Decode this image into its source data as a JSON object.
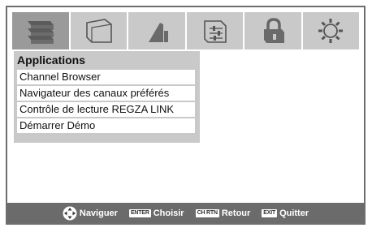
{
  "top_tabs": [
    {
      "icon": "applications-icon",
      "active": true
    },
    {
      "icon": "picture-icon",
      "active": false
    },
    {
      "icon": "audio-icon",
      "active": false
    },
    {
      "icon": "preferences-icon",
      "active": false
    },
    {
      "icon": "lock-icon",
      "active": false
    },
    {
      "icon": "setup-icon",
      "active": false
    }
  ],
  "menu": {
    "title": "Applications",
    "items": [
      "Channel Browser",
      "Navigateur des canaux préférés",
      "Contrôle de lecture REGZA LINK",
      "Démarrer Démo"
    ]
  },
  "bottom_bar": {
    "navigate_label": "Naviguer",
    "choose_key": "ENTER",
    "choose_label": "Choisir",
    "back_key": "CH RTN",
    "back_label": "Retour",
    "exit_key": "EXIT",
    "exit_label": "Quitter"
  }
}
